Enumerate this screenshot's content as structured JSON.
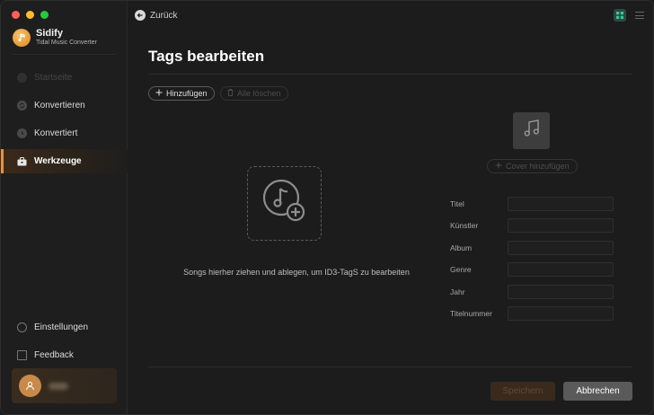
{
  "app": {
    "name": "Sidify",
    "subtitle": "Tidal Music Converter"
  },
  "sidebar": {
    "items": [
      {
        "label": "Startseite",
        "icon": "home-icon",
        "state": "disabled"
      },
      {
        "label": "Konvertieren",
        "icon": "convert-icon",
        "state": "normal"
      },
      {
        "label": "Konvertiert",
        "icon": "clock-icon",
        "state": "normal"
      },
      {
        "label": "Werkzeuge",
        "icon": "toolbox-icon",
        "state": "active"
      }
    ],
    "bottom": [
      {
        "label": "Einstellungen",
        "icon": "settings-icon"
      },
      {
        "label": "Feedback",
        "icon": "mail-icon"
      }
    ]
  },
  "header": {
    "back_label": "Zurück"
  },
  "page": {
    "title": "Tags bearbeiten",
    "add_label": "Hinzufügen",
    "clear_label": "Alle löschen",
    "drop_text": "Songs hierher ziehen und ablegen, um ID3-TagS zu bearbeiten",
    "cover_label": "Cover hinzufügen",
    "fields": [
      "Titel",
      "Künstler",
      "Album",
      "Genre",
      "Jahr",
      "Titelnummer"
    ],
    "save_label": "Speichern",
    "cancel_label": "Abbrechen"
  },
  "colors": {
    "accent": "#e8913a",
    "background": "#1c1c1c"
  }
}
